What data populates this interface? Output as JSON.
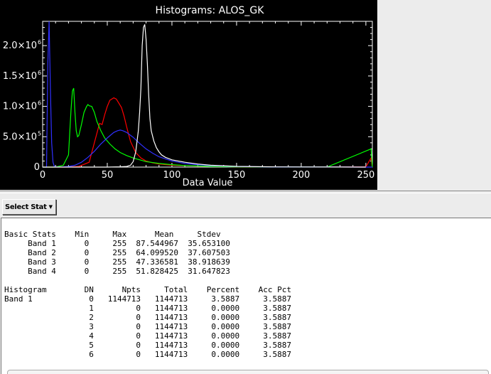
{
  "window": {
    "select_stat_label": "Select Stat",
    "select_stat_icon": "dropdown-arrow-icon"
  },
  "chart_data": {
    "type": "line",
    "title": "Histograms: ALOS_GK",
    "xlabel": "Data Value",
    "ylabel": "",
    "xlim": [
      0,
      255
    ],
    "ylim": [
      0,
      2400000
    ],
    "x_ticks": [
      0,
      50,
      100,
      150,
      200,
      250
    ],
    "x_tick_labels": [
      "0",
      "50",
      "100",
      "150",
      "200",
      "250"
    ],
    "y_ticks": [
      0,
      500000,
      1000000,
      1500000,
      2000000
    ],
    "y_tick_labels": [
      "0",
      "5.0×10",
      "1.0×10",
      "1.5×10",
      "2.0×10"
    ],
    "y_tick_exponents": [
      "",
      "5",
      "6",
      "6",
      "6"
    ],
    "grid": false,
    "series": [
      {
        "color": "#ff0000",
        "x": [
          0,
          3,
          6,
          12,
          20,
          28,
          36,
          40,
          44,
          46,
          48,
          50,
          52,
          55,
          57,
          59,
          61,
          63,
          65,
          68,
          72,
          76,
          80,
          85,
          90,
          100,
          120,
          150,
          180,
          230,
          250,
          254,
          255
        ],
        "y": [
          0,
          0,
          0,
          0,
          0,
          10000,
          80000,
          400000,
          720000,
          700000,
          860000,
          1000000,
          1100000,
          1140000,
          1120000,
          1050000,
          980000,
          840000,
          660000,
          420000,
          240000,
          150000,
          100000,
          70000,
          50000,
          30000,
          15000,
          5000,
          2000,
          1000,
          3000,
          150000,
          0
        ]
      },
      {
        "color": "#00ff00",
        "x": [
          0,
          3,
          6,
          10,
          16,
          20,
          22,
          23,
          24,
          25,
          26,
          27,
          28,
          30,
          32,
          34,
          35,
          36,
          38,
          40,
          42,
          45,
          48,
          52,
          56,
          60,
          65,
          70,
          80,
          90,
          100,
          110,
          130,
          150,
          180,
          220,
          254,
          255
        ],
        "y": [
          0,
          0,
          0,
          0,
          30000,
          200000,
          950000,
          1250000,
          1300000,
          900000,
          600000,
          500000,
          520000,
          700000,
          900000,
          1000000,
          1030000,
          1010000,
          1000000,
          900000,
          750000,
          600000,
          480000,
          380000,
          300000,
          240000,
          190000,
          150000,
          90000,
          60000,
          40000,
          25000,
          12000,
          5000,
          2000,
          1000,
          300000,
          0
        ]
      },
      {
        "color": "#3030ff",
        "x": [
          0,
          3,
          4,
          5,
          6,
          7,
          8,
          9,
          10,
          12,
          15,
          20,
          25,
          30,
          35,
          40,
          45,
          50,
          55,
          58,
          60,
          62,
          65,
          70,
          75,
          80,
          85,
          90,
          100,
          110,
          120,
          130,
          150,
          170,
          200,
          230,
          250,
          255
        ],
        "y": [
          0,
          0,
          1700000,
          2450000,
          1300000,
          400000,
          80000,
          10000,
          1000,
          0,
          2000,
          10000,
          30000,
          80000,
          160000,
          260000,
          380000,
          480000,
          570000,
          600000,
          610000,
          600000,
          570000,
          490000,
          390000,
          300000,
          230000,
          170000,
          100000,
          60000,
          40000,
          25000,
          10000,
          4000,
          2000,
          1000,
          0,
          0
        ]
      },
      {
        "color": "#ffffff",
        "x": [
          0,
          10,
          30,
          50,
          60,
          65,
          68,
          70,
          72,
          74,
          75,
          76,
          77,
          78,
          79,
          80,
          81,
          82,
          83,
          84,
          86,
          88,
          90,
          92,
          95,
          100,
          110,
          120,
          130,
          150,
          180,
          200,
          230,
          250
        ],
        "y": [
          0,
          0,
          0,
          0,
          5000,
          10000,
          30000,
          90000,
          250000,
          600000,
          900000,
          1300000,
          2000000,
          2300000,
          2350000,
          2100000,
          1700000,
          1200000,
          800000,
          600000,
          430000,
          320000,
          250000,
          200000,
          160000,
          120000,
          80000,
          50000,
          30000,
          12000,
          4000,
          2000,
          1000,
          500
        ]
      }
    ]
  },
  "stats": {
    "lines": [
      "Basic Stats    Min     Max      Mean     Stdev",
      "     Band 1      0     255  87.544967  35.653100",
      "     Band 2      0     255  64.099520  37.607503",
      "     Band 3      0     255  47.336581  38.918639",
      "     Band 4      0     255  51.828425  31.647823",
      "",
      "Histogram        DN      Npts     Total    Percent    Acc Pct",
      "Band 1            0   1144713   1144713     3.5887     3.5887",
      "                  1         0   1144713     0.0000     3.5887",
      "                  2         0   1144713     0.0000     3.5887",
      "                  3         0   1144713     0.0000     3.5887",
      "                  4         0   1144713     0.0000     3.5887",
      "                  5         0   1144713     0.0000     3.5887",
      "                  6         0   1144713     0.0000     3.5887"
    ]
  }
}
